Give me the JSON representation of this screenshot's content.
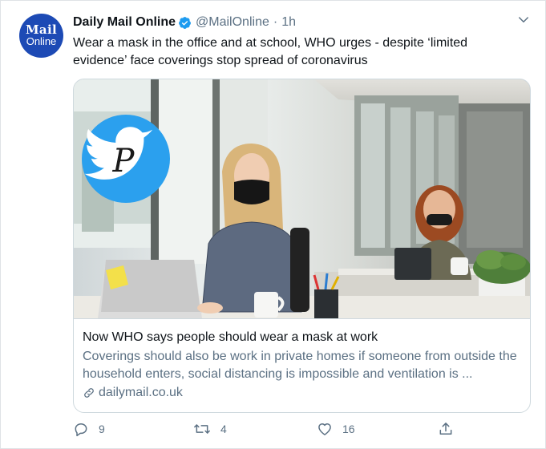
{
  "colors": {
    "accent": "#1d9bf0",
    "brand": "#1d4ab5",
    "muted": "#5b7083"
  },
  "author": {
    "avatar_line1": "Mail",
    "avatar_line2": "Online",
    "name": "Daily Mail Online",
    "verified_icon": "verified-badge-icon",
    "handle": "@MailOnline",
    "separator": "·",
    "time": "1h"
  },
  "tweet": {
    "text": "Wear a mask in the office and at school, WHO urges - despite ‘limited evidence’ face coverings stop spread of coronavirus"
  },
  "card": {
    "image_icon": "twitter-bird-logo-icon",
    "title": "Now WHO says people should wear a mask at work",
    "description": "Coverings should also be work in private homes if someone from outside the household enters, social distancing is impossible and ventilation is ...",
    "domain": "dailymail.co.uk",
    "domain_icon": "link-icon"
  },
  "actions": {
    "replies": "9",
    "retweets": "4",
    "likes": "16",
    "reply_icon": "reply-icon",
    "retweet_icon": "retweet-icon",
    "like_icon": "heart-icon",
    "share_icon": "share-icon"
  }
}
